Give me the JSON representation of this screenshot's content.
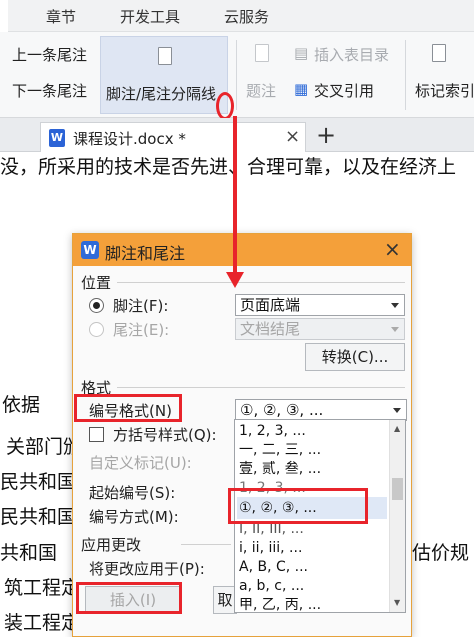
{
  "menubar": {
    "items": [
      "章节",
      "开发工具",
      "云服务"
    ]
  },
  "ribbon": {
    "prev_endnote": "上一条尾注",
    "next_endnote": "下一条尾注",
    "separator_btn": "脚注/尾注分隔线",
    "caption": "题注",
    "insert_toc": "插入表目录",
    "cross_ref": "交叉引用",
    "mark_index": "标记索引"
  },
  "tab": {
    "filename": "课程设计.docx *",
    "close": "×",
    "add": "+"
  },
  "doc_lines": {
    "top": "没，所采用的技术是否先进、合理可靠，以及在经济上",
    "l1": "依据",
    "l2": "关部门颁",
    "l3": "民共和国",
    "l4": "民共和国",
    "l5": "共和国",
    "l5b": "估价规",
    "l6": "筑工程定",
    "l7": "装工程定额"
  },
  "dialog": {
    "title": "脚注和尾注",
    "close": "×",
    "position_group": "位置",
    "footnote_label": "脚注(F):",
    "footnote_value": "页面底端",
    "endnote_label": "尾注(E):",
    "endnote_value": "文档结尾",
    "convert_btn": "转换(C)...",
    "format_group": "格式",
    "number_format_label": "编号格式(N)",
    "number_format_value": "①, ②, ③, ...",
    "bracket_style_label": "方括号样式(Q):",
    "custom_mark_label": "自定义标记(U):",
    "start_num_label": "起始编号(S):",
    "numbering_label": "编号方式(M):",
    "apply_group": "应用更改",
    "apply_to_label": "将更改应用于(P):",
    "insert_btn": "插入(I)",
    "other_btn": "取"
  },
  "dropdown_options": [
    "1, 2, 3, ...",
    "一, 二, 三, ...",
    "壹, 贰, 叁, ...",
    "1, 2, 3, ...",
    "①, ②, ③, ...",
    "I, II, III, ...",
    "i, ii, iii, ...",
    "A, B, C, ...",
    "a, b, c, ...",
    "甲, 乙, 丙, ..."
  ],
  "colors": {
    "dialog_title_bg": "#f4a03a",
    "annotation_red": "#e8242b",
    "selected_item_bg": "#dfe8f6"
  }
}
